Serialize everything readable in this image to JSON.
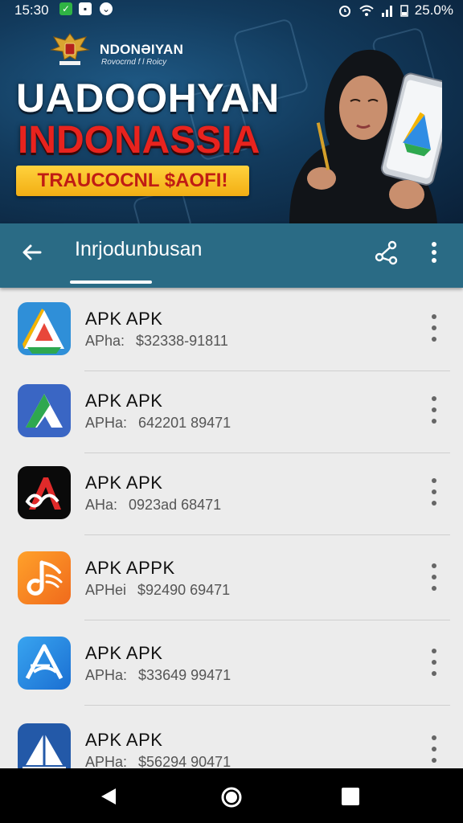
{
  "status_bar": {
    "time": "15:30",
    "battery": "25.0%"
  },
  "banner": {
    "brand_title": "NDONƏIYAN",
    "brand_subtitle": "Rovocrnd f l Roicy",
    "headline_line1": "UADOOHYAN",
    "headline_line2": "INDONASSIA",
    "promo_text": "TRAUCOCNL $AOFI!"
  },
  "appbar": {
    "title": "Inrjodunbusan"
  },
  "apps": [
    {
      "name": "APK APK",
      "meta_key": "APha:",
      "meta_value": "$32338-91811",
      "icon": "drive-like-icon"
    },
    {
      "name": "APK APK",
      "meta_key": "APHa:",
      "meta_value": "642201 89471",
      "icon": "triangle-blue-icon"
    },
    {
      "name": "APK APK",
      "meta_key": "AHa:",
      "meta_value": "0923ad 68471",
      "icon": "red-a-icon"
    },
    {
      "name": "APK APPK",
      "meta_key": "APHei",
      "meta_value": "$92490 69471",
      "icon": "orange-note-icon"
    },
    {
      "name": "APK APK",
      "meta_key": "APHa:",
      "meta_value": "$33649 99471",
      "icon": "blue-a-icon"
    },
    {
      "name": "APK APK",
      "meta_key": "APHa:",
      "meta_value": "$56294 90471",
      "icon": "sail-icon"
    }
  ],
  "colors": {
    "appbar": "#2a6b85",
    "banner_dark": "#0a2038",
    "promo": "#ffd23d",
    "headline_red": "#e8231e"
  }
}
